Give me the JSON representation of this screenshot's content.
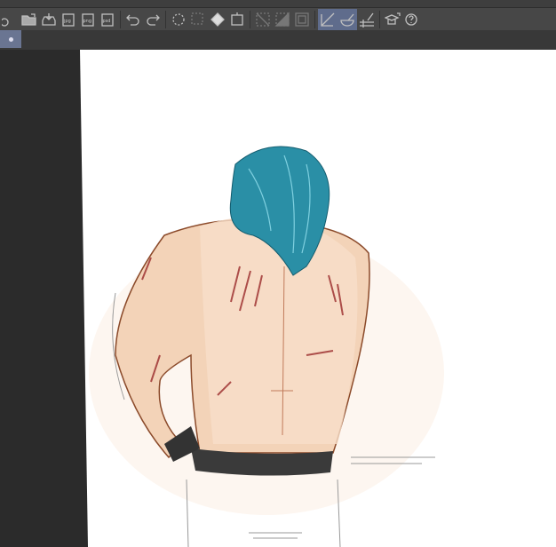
{
  "toolbar": {
    "items": [
      {
        "name": "new-file",
        "label": ""
      },
      {
        "name": "open-file",
        "label": ""
      },
      {
        "name": "save",
        "label": ""
      },
      {
        "name": "export-jpg",
        "label": "jpg"
      },
      {
        "name": "export-png",
        "label": "png"
      },
      {
        "name": "export-psd",
        "label": "psd"
      },
      {
        "name": "undo",
        "label": ""
      },
      {
        "name": "redo",
        "label": ""
      },
      {
        "name": "deselect",
        "label": ""
      },
      {
        "name": "invert-selection",
        "label": ""
      },
      {
        "name": "fill",
        "label": ""
      },
      {
        "name": "transform",
        "label": ""
      },
      {
        "name": "clear-outside",
        "label": ""
      },
      {
        "name": "fill-selection",
        "label": ""
      },
      {
        "name": "border-selection",
        "label": ""
      },
      {
        "name": "snap-to-ruler",
        "label": ""
      },
      {
        "name": "snap-to-special-ruler",
        "label": ""
      },
      {
        "name": "snap-to-grid",
        "label": ""
      },
      {
        "name": "learn",
        "label": ""
      },
      {
        "name": "help",
        "label": ""
      }
    ]
  },
  "document_tab": {
    "label": ""
  },
  "colors": {
    "accent": "#5f6c8c",
    "hair": "#2a8fa6",
    "skin": "#f3d3b8",
    "scar": "#9a2a2a"
  }
}
